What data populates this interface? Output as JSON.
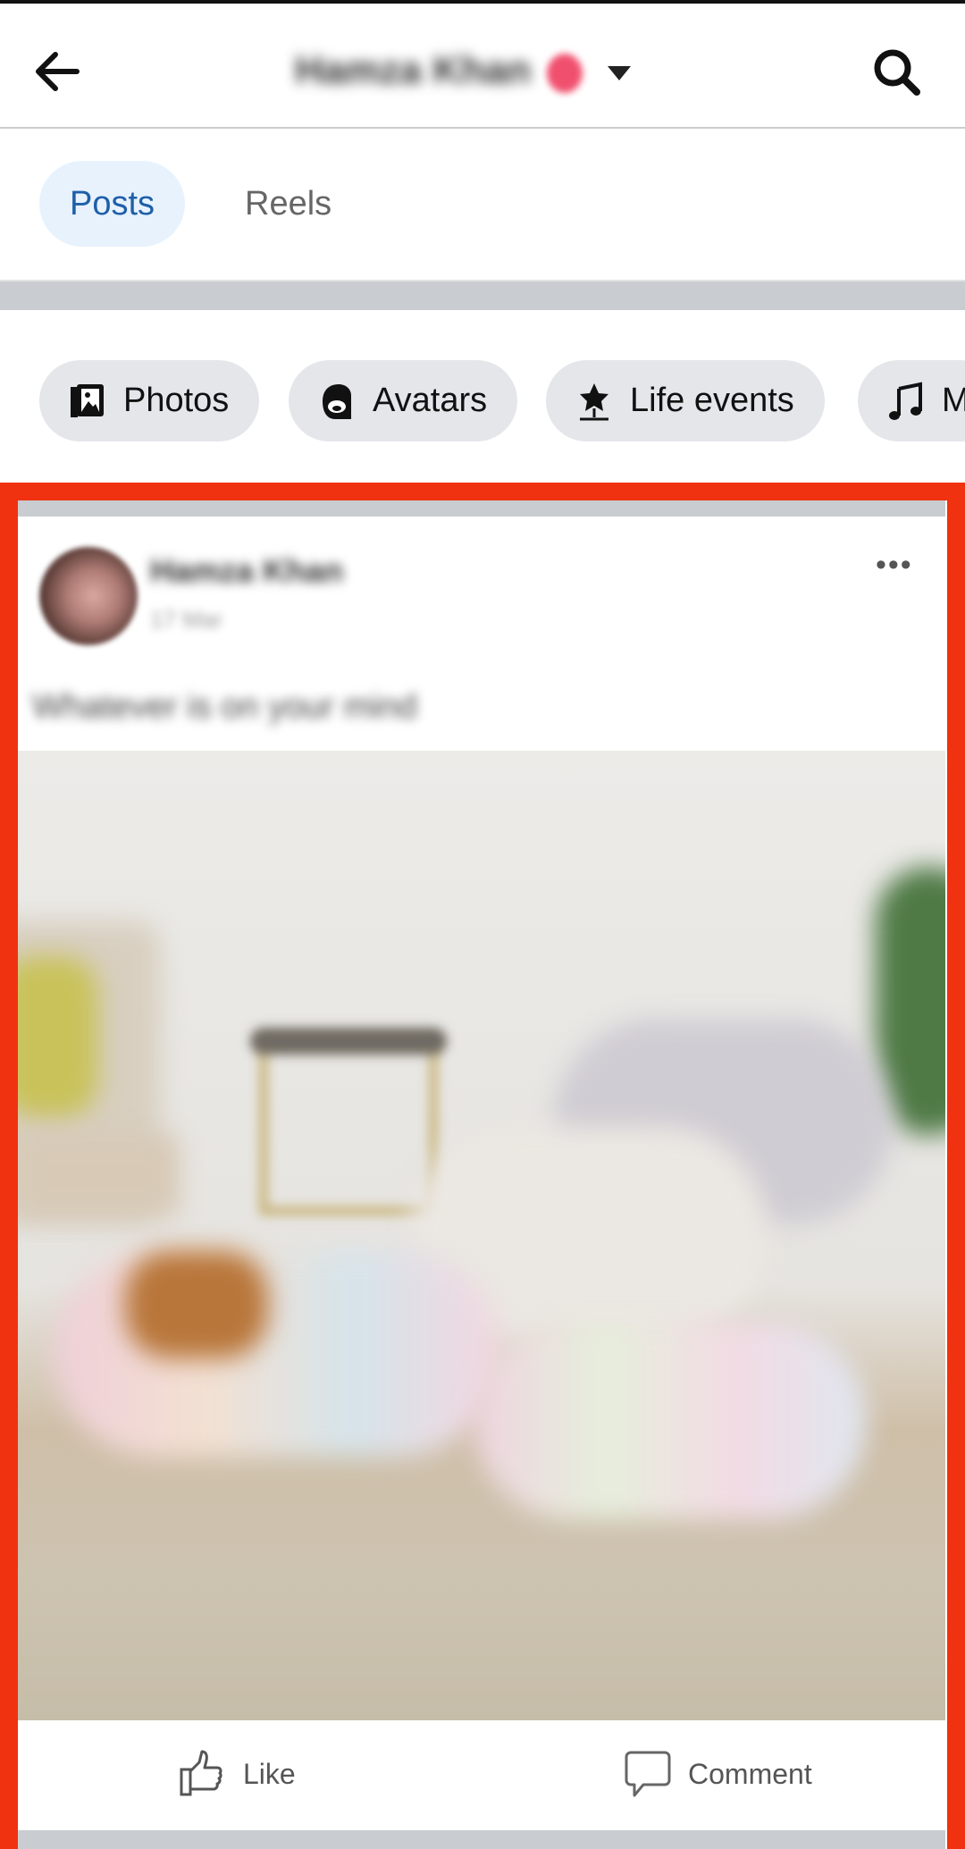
{
  "header": {
    "title": "Hamza Khan",
    "back_icon": "arrow-left-icon",
    "search_icon": "search-icon"
  },
  "tabs": [
    {
      "label": "Posts",
      "active": true
    },
    {
      "label": "Reels",
      "active": false
    }
  ],
  "filters": [
    {
      "label": "Photos",
      "icon": "photos-icon"
    },
    {
      "label": "Avatars",
      "icon": "avatar-icon"
    },
    {
      "label": "Life events",
      "icon": "star-flag-icon"
    },
    {
      "label": "M",
      "icon": "music-note-icon"
    }
  ],
  "post": {
    "author": "Hamza Khan",
    "time": "17 Mar",
    "caption": "Whatever is on your mind",
    "like_label": "Like",
    "comment_label": "Comment"
  },
  "colors": {
    "highlight_border": "#f03210",
    "active_tab_bg": "#e7f2fd",
    "active_tab_text": "#1f5fa8"
  }
}
